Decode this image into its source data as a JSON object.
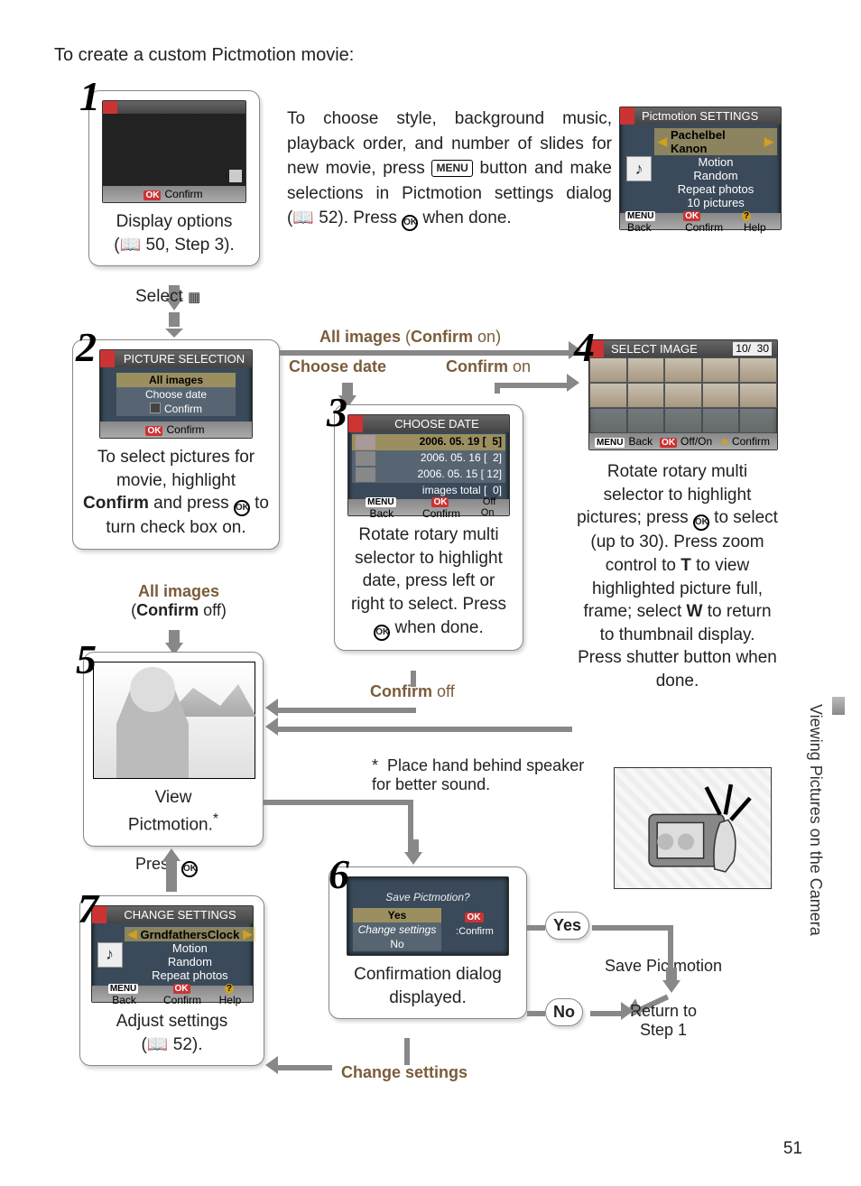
{
  "page": {
    "side_label": "Viewing Pictures on the Camera",
    "page_number": "51",
    "title": "To create a custom Pictmotion movie:"
  },
  "intro": {
    "line1": "To choose style, background music, playback order, and number of slides for new movie, press ",
    "menu_key": "MENU",
    "line2": " button and make selections in Pictmotion settings dialog (",
    "dialog_ref": "52",
    "line3": ").  Press ",
    "ok": "OK",
    "line4": " when done."
  },
  "select_caption": "Select",
  "step1": {
    "num": "1",
    "caption1": "Display options",
    "caption2_prefix": "(",
    "caption2_ref": "50, Step 3",
    "caption2_suffix": ").",
    "confirm": "Confirm"
  },
  "step2": {
    "num": "2",
    "lcd_title": "PICTURE SELECTION",
    "opt_all": "All images",
    "opt_date": "Choose date",
    "opt_confirm": "Confirm",
    "foot_ok": "OK",
    "foot_confirm": "Confirm",
    "para_l1": "To select pictures for movie, highlight ",
    "para_bold": "Confirm",
    "para_l2": " and press ",
    "para_l3": " to turn check box on.",
    "branch_all_bold": "All images",
    "branch_all_tail": "(",
    "branch_all_c": "Confirm",
    "branch_all_off": " off)"
  },
  "top_labels": {
    "all_images_pre": "All images",
    "all_images_tail": " (",
    "all_images_c": "Confirm",
    "all_images_on": " on)",
    "choose_date": "Choose date",
    "confirm_on_pre": "Confirm",
    "confirm_on": " on"
  },
  "step3": {
    "num": "3",
    "lcd_title": "CHOOSE DATE",
    "rows": [
      {
        "date": "2006. 05. 19",
        "count": "5"
      },
      {
        "date": "2006. 05. 16",
        "count": "2"
      },
      {
        "date": "2006. 05. 15",
        "count": "12"
      }
    ],
    "total_label": "images total",
    "total_count": "0",
    "foot_back": "Back",
    "foot_confirm": "Confirm",
    "foot_offon": "Off  On",
    "para": "Rotate rotary multi selector to highlight date, press left or right to select.  Press ",
    "para2": " when done.",
    "confirm_off_label_pre": "Confirm",
    "confirm_off_label": " off"
  },
  "step4": {
    "num": "4",
    "lcd_title": "SELECT IMAGE",
    "counter_cur": "10",
    "counter_sep": "/",
    "counter_total": "30",
    "foot_back": "Back",
    "foot_offon": "Off/On",
    "foot_confirm": "Confirm",
    "para_l1": "Rotate rotary multi selector to highlight pictures; press ",
    "para_l2": " to select (up to 30).  Press zoom control to ",
    "para_T": "T",
    "para_l3": " to view highlighted picture full, frame; select ",
    "para_W": "W",
    "para_l4": " to return to thumbnail display.  Press shutter button when done."
  },
  "step5": {
    "num": "5",
    "caption1": "View",
    "caption2": "Pictmotion.",
    "footnote_mark": "*",
    "press_label": "Press "
  },
  "footnote": {
    "mark": "*",
    "text": "Place hand behind speaker for better sound."
  },
  "step6": {
    "num": "6",
    "lcd_prompt": "Save Pictmotion?",
    "opt_yes": "Yes",
    "opt_change": "Change settings",
    "opt_no": "No",
    "foot_key": "OK",
    "foot_confirm": ":Confirm",
    "caption": "Confirmation dialog displayed.",
    "yes": "Yes",
    "no": "No",
    "save_label": "Save Pictmotion",
    "return_label1": "Return to",
    "return_label2": "Step 1",
    "change_settings_label": "Change settings"
  },
  "step7": {
    "num": "7",
    "lcd_title": "CHANGE SETTINGS",
    "row1": "GrndfathersClock",
    "row2": "Motion",
    "row3": "Random",
    "row4": "Repeat photos",
    "foot_back": "Back",
    "foot_confirm": "Confirm",
    "foot_help": "Help",
    "caption1": "Adjust settings",
    "caption2_prefix": "(",
    "caption2_ref": "52",
    "caption2_suffix": ")."
  },
  "right_settings": {
    "lcd_title": "Pictmotion SETTINGS",
    "row1": "Pachelbel Kanon",
    "row2": "Motion",
    "row3": "Random",
    "row4": "Repeat photos",
    "row5": "10 pictures",
    "foot_back": "Back",
    "foot_confirm": "Confirm",
    "foot_help": "Help"
  }
}
